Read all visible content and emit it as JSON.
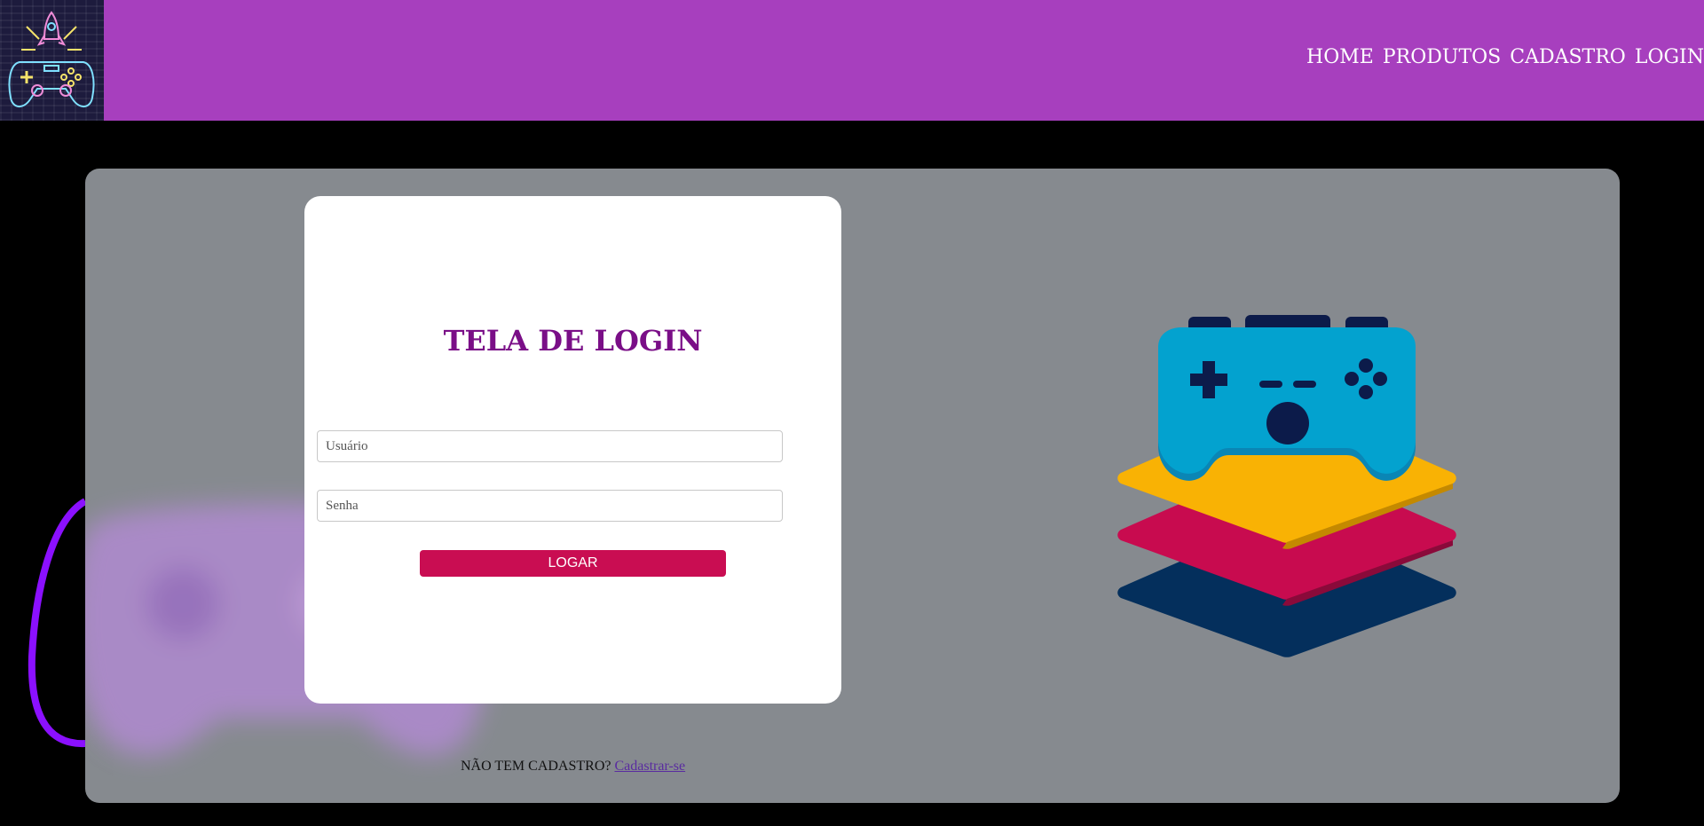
{
  "header": {
    "logo_icon": "neon-rocket-gamepad-logo",
    "background_color": "#a73fbe"
  },
  "nav": {
    "items": [
      {
        "label": "HOME"
      },
      {
        "label": "PRODUTOS"
      },
      {
        "label": "CADASTRO"
      },
      {
        "label": "LOGIN"
      }
    ]
  },
  "login": {
    "title": "TELA DE LOGIN",
    "username_placeholder": "Usuário",
    "password_placeholder": "Senha",
    "submit_label": "LOGAR",
    "title_color": "#7a0e87",
    "button_color": "#c90d52"
  },
  "signup": {
    "prompt": "NÃO TEM CADASTRO?",
    "link_label": "Cadastrar-se"
  },
  "illustration": {
    "icon": "gamepad-on-layers-icon"
  }
}
